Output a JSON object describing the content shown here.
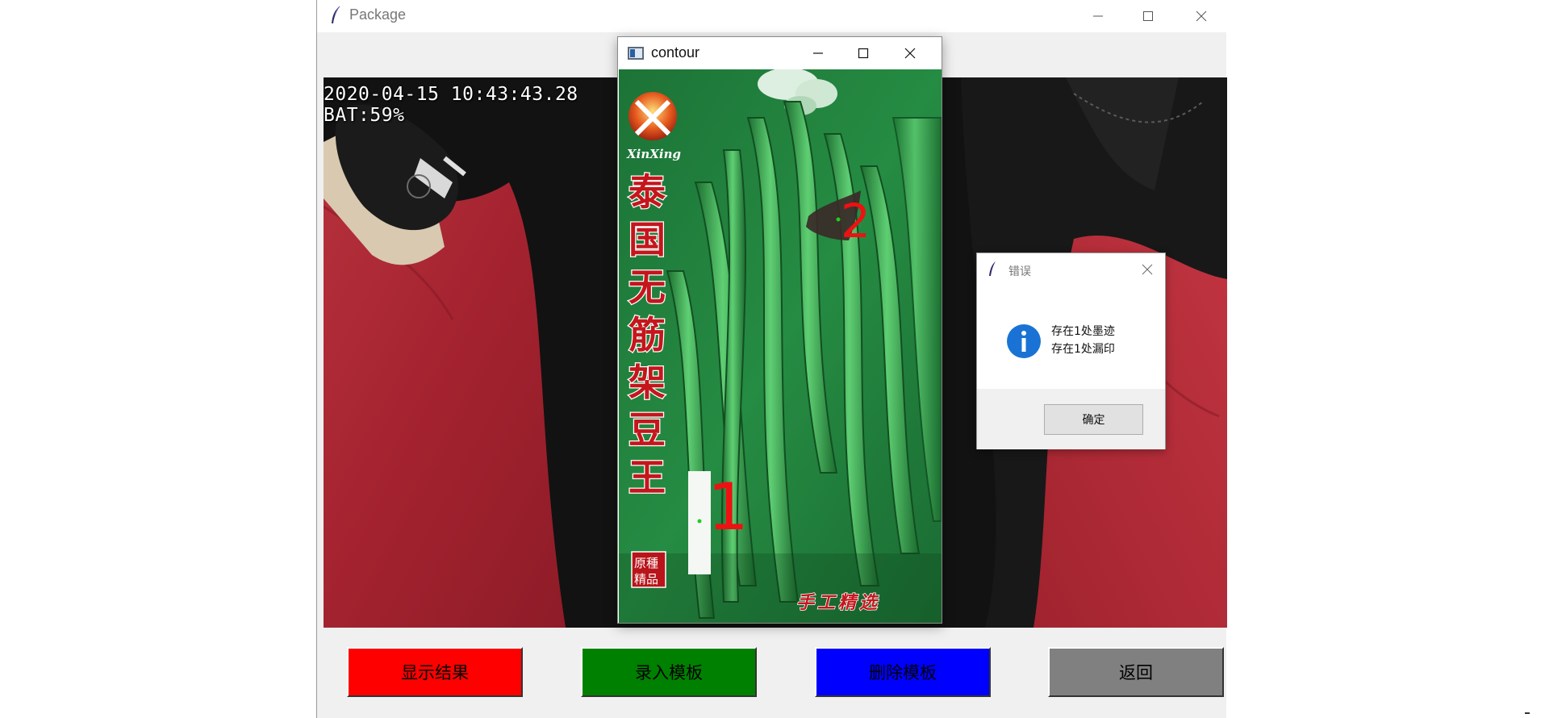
{
  "main_window": {
    "title": "Package",
    "icon": "feather-icon",
    "controls": [
      "minimize-icon",
      "maximize-icon",
      "close-icon"
    ]
  },
  "camera": {
    "timestamp": "2020-04-15 10:43:43.28",
    "battery": "BAT:59%"
  },
  "buttons": {
    "show_result": {
      "label": "显示结果",
      "color": "#ff0000",
      "text_color": "#000000"
    },
    "record_template": {
      "label": "录入模板",
      "color": "#008000",
      "text_color": "#000000"
    },
    "delete_template": {
      "label": "删除模板",
      "color": "#0000ff",
      "text_color": "#000000"
    },
    "back": {
      "label": "返回",
      "color": "#808080",
      "text_color": "#000000"
    }
  },
  "contour_window": {
    "title": "contour",
    "controls": [
      "minimize-icon",
      "maximize-icon",
      "close-icon"
    ],
    "package": {
      "brand": "XinXing",
      "product_name": "泰国无筋架豆王",
      "seal_text": "原種精品",
      "tagline": "手工精选"
    },
    "defect_labels": [
      "1",
      "2"
    ]
  },
  "error_dialog": {
    "title": "错误",
    "icon": "info-icon",
    "messages": [
      "存在1处墨迹",
      "存在1处漏印"
    ],
    "ok_label": "确定"
  },
  "colors": {
    "window_bg": "#f0f0f0",
    "defect_label": "#ee1111",
    "defect_marker": "#22cc22",
    "info_icon": "#1a73d4"
  }
}
